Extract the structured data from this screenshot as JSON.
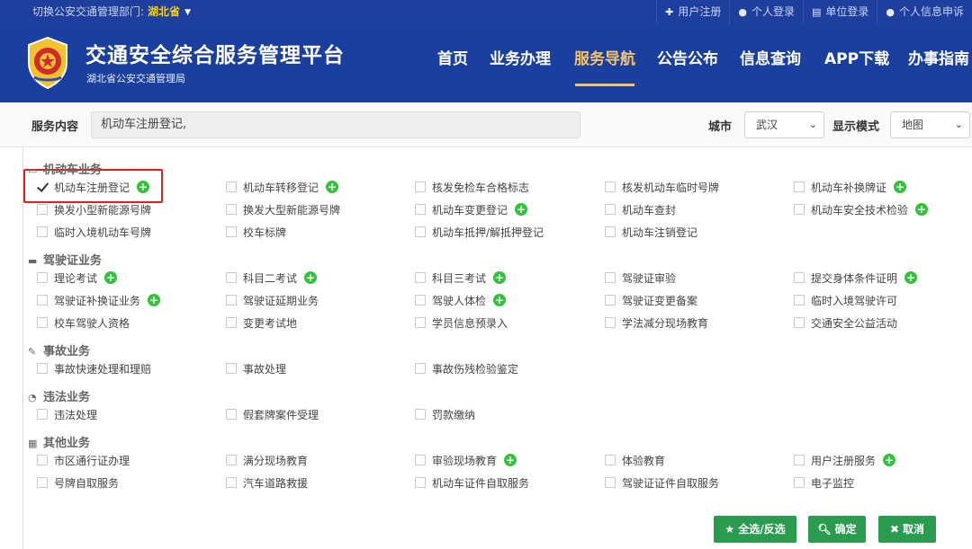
{
  "topbar": {
    "switch_label": "切换公安交通管理部门:",
    "province": "湖北省",
    "links": [
      {
        "icon": "plus-icon",
        "glyph": "✚",
        "label": "用户注册"
      },
      {
        "icon": "user-icon",
        "glyph": "👤",
        "label": "个人登录"
      },
      {
        "icon": "document-icon",
        "glyph": "▤",
        "label": "单位登录"
      },
      {
        "icon": "user-icon",
        "glyph": "👤",
        "label": "个人信息申诉"
      }
    ]
  },
  "header": {
    "title": "交通安全综合服务管理平台",
    "subtitle": "湖北省公安交通管理局",
    "nav": [
      "首页",
      "业务办理",
      "服务导航",
      "公告公布",
      "信息查询",
      "APP下载",
      "办事指南"
    ],
    "active_nav": "服务导航"
  },
  "filter": {
    "service_label": "服务内容",
    "service_value": "机动车注册登记,",
    "city_label": "城市",
    "city_value": "武汉",
    "mode_label": "显示模式",
    "mode_value": "地图"
  },
  "categories": [
    {
      "name": "机动车业务",
      "icon": "vehicle-icon",
      "items": [
        {
          "label": "机动车注册登记",
          "checked": true,
          "plus": true
        },
        {
          "label": "机动车转移登记",
          "checked": false,
          "plus": true
        },
        {
          "label": "核发免检车合格标志",
          "checked": false,
          "plus": false
        },
        {
          "label": "核发机动车临时号牌",
          "checked": false,
          "plus": false
        },
        {
          "label": "机动车补换牌证",
          "checked": false,
          "plus": true
        },
        {
          "label": "换发小型新能源号牌",
          "checked": false,
          "plus": false
        },
        {
          "label": "换发大型新能源号牌",
          "checked": false,
          "plus": false
        },
        {
          "label": "机动车变更登记",
          "checked": false,
          "plus": true
        },
        {
          "label": "机动车查封",
          "checked": false,
          "plus": false
        },
        {
          "label": "机动车安全技术检验",
          "checked": false,
          "plus": true
        },
        {
          "label": "临时入境机动车号牌",
          "checked": false,
          "plus": false
        },
        {
          "label": "校车标牌",
          "checked": false,
          "plus": false
        },
        {
          "label": "机动车抵押/解抵押登记",
          "checked": false,
          "plus": false
        },
        {
          "label": "机动车注销登记",
          "checked": false,
          "plus": false
        }
      ]
    },
    {
      "name": "驾驶证业务",
      "icon": "license-card-icon",
      "items": [
        {
          "label": "理论考试",
          "checked": false,
          "plus": true
        },
        {
          "label": "科目二考试",
          "checked": false,
          "plus": true
        },
        {
          "label": "科目三考试",
          "checked": false,
          "plus": true
        },
        {
          "label": "驾驶证审验",
          "checked": false,
          "plus": false
        },
        {
          "label": "提交身体条件证明",
          "checked": false,
          "plus": true
        },
        {
          "label": "驾驶证补换证业务",
          "checked": false,
          "plus": true
        },
        {
          "label": "驾驶证延期业务",
          "checked": false,
          "plus": false
        },
        {
          "label": "驾驶人体检",
          "checked": false,
          "plus": true
        },
        {
          "label": "驾驶证变更备案",
          "checked": false,
          "plus": false
        },
        {
          "label": "临时入境驾驶许可",
          "checked": false,
          "plus": false
        },
        {
          "label": "校车驾驶人资格",
          "checked": false,
          "plus": false
        },
        {
          "label": "变更考试地",
          "checked": false,
          "plus": false
        },
        {
          "label": "学员信息预录入",
          "checked": false,
          "plus": false
        },
        {
          "label": "学法减分现场教育",
          "checked": false,
          "plus": false
        },
        {
          "label": "交通安全公益活动",
          "checked": false,
          "plus": false
        }
      ]
    },
    {
      "name": "事故业务",
      "icon": "accident-icon",
      "items": [
        {
          "label": "事故快速处理和理赔",
          "checked": false,
          "plus": false
        },
        {
          "label": "事故处理",
          "checked": false,
          "plus": false
        },
        {
          "label": "事故伤残检验鉴定",
          "checked": false,
          "plus": false
        }
      ]
    },
    {
      "name": "违法业务",
      "icon": "violation-icon",
      "items": [
        {
          "label": "违法处理",
          "checked": false,
          "plus": false
        },
        {
          "label": "假套牌案件受理",
          "checked": false,
          "plus": false
        },
        {
          "label": "罚款缴纳",
          "checked": false,
          "plus": false
        }
      ]
    },
    {
      "name": "其他业务",
      "icon": "grid-icon",
      "items": [
        {
          "label": "市区通行证办理",
          "checked": false,
          "plus": false
        },
        {
          "label": "满分现场教育",
          "checked": false,
          "plus": false
        },
        {
          "label": "审验现场教育",
          "checked": false,
          "plus": true
        },
        {
          "label": "体验教育",
          "checked": false,
          "plus": false
        },
        {
          "label": "用户注册服务",
          "checked": false,
          "plus": true
        },
        {
          "label": "号牌自取服务",
          "checked": false,
          "plus": false
        },
        {
          "label": "汽车道路救援",
          "checked": false,
          "plus": false
        },
        {
          "label": "机动车证件自取服务",
          "checked": false,
          "plus": false
        },
        {
          "label": "驾驶证证件自取服务",
          "checked": false,
          "plus": false
        },
        {
          "label": "电子监控",
          "checked": false,
          "plus": false
        }
      ]
    }
  ],
  "buttons": {
    "select_all": "全选/反选",
    "confirm": "确定",
    "cancel": "取消"
  },
  "colors": {
    "header_bg": "#1a3f9f",
    "topbar_bg": "#1f3f9e",
    "active_nav": "#f5c36d",
    "plus_green": "#33c23b",
    "button_green": "#2a9b4f",
    "highlight_red": "#e21e1e"
  }
}
